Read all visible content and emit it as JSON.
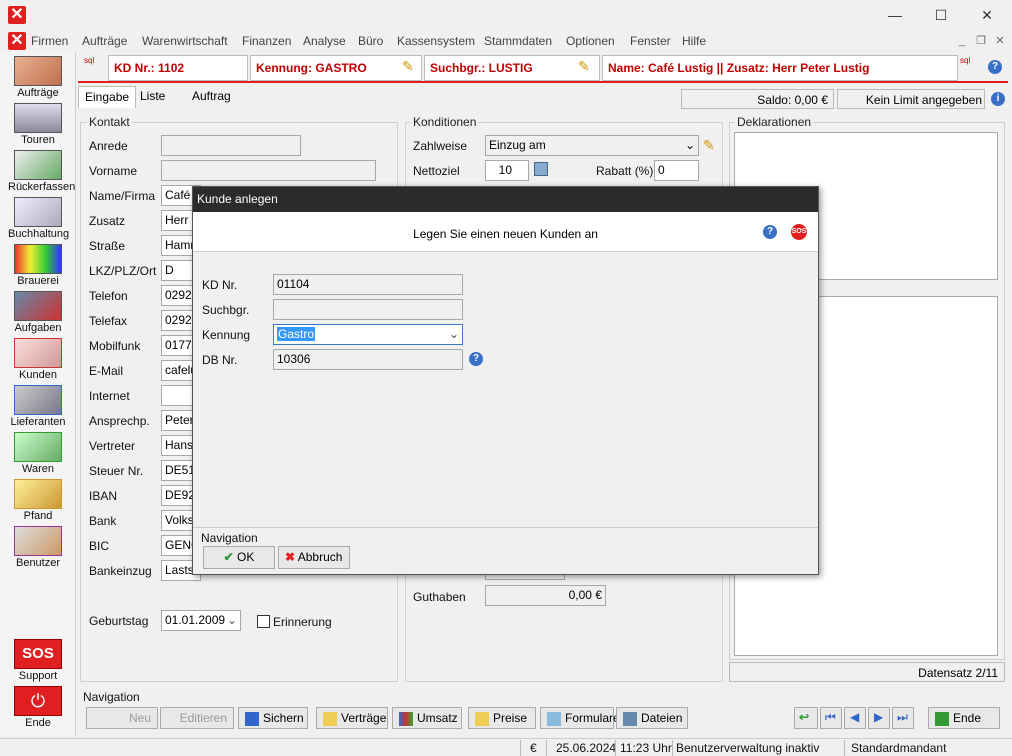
{
  "window": {
    "minimize": "—",
    "maximize": "☐",
    "close": "✕"
  },
  "menu": [
    "Firmen",
    "Aufträge",
    "Warenwirtschaft",
    "Finanzen",
    "Analyse",
    "Büro",
    "Kassensystem",
    "Stammdaten",
    "Optionen",
    "Fenster",
    "Hilfe"
  ],
  "sidebar": [
    "Aufträge",
    "Touren",
    "Rückerfassen",
    "Buchhaltung",
    "Brauerei",
    "Aufgaben",
    "Kunden",
    "Lieferanten",
    "Waren",
    "Pfand",
    "Benutzer",
    "Support",
    "Ende"
  ],
  "header": {
    "kd_nr": "KD Nr.: 1102",
    "kennung": "Kennung: GASTRO",
    "suchbgr": "Suchbgr.: LUSTIG",
    "name": "Name: Café Lustig || Zusatz: Herr Peter Lustig",
    "sql": "sql"
  },
  "tabs": [
    "Eingabe",
    "Liste",
    "Auftrag"
  ],
  "saldo": "Saldo: 0,00 €",
  "limit": "Kein Limit angegeben",
  "kontakt": {
    "title": "Kontakt",
    "labels": [
      "Anrede",
      "Vorname",
      "Name/Firma",
      "Zusatz",
      "Straße",
      "LKZ/PLZ/Ort",
      "Telefon",
      "Telefax",
      "Mobilfunk",
      "E-Mail",
      "Internet",
      "Ansprechp.",
      "Vertreter",
      "Steuer Nr.",
      "IBAN",
      "Bank",
      "BIC",
      "Bankeinzug"
    ],
    "values": [
      "",
      "",
      "Café L",
      "Herr P",
      "Hamm",
      "D",
      "02924",
      "02924",
      "0177-",
      "cafelu",
      "",
      "Peter",
      "Hans",
      "DE51",
      "DE92",
      "Volks",
      "GENO",
      "Lasts"
    ],
    "geburtstag_label": "Geburtstag",
    "geburtstag": "01.01.2009",
    "erinnerung": "Erinnerung"
  },
  "konditionen": {
    "title": "Konditionen",
    "zahlweise_label": "Zahlweise",
    "zahlweise": "Einzug am",
    "nettoziel_label": "Nettoziel",
    "nettoziel": "10",
    "rabatt_label": "Rabatt (%)",
    "rabatt": "0",
    "guthaben_label": "Guthaben",
    "guthaben": "0,00 €"
  },
  "deklarationen": {
    "title": "Deklarationen"
  },
  "datensatz": "Datensatz 2/11",
  "navigation": {
    "title": "Navigation",
    "buttons": [
      "Neu",
      "Editieren",
      "Sichern",
      "Verträge",
      "Umsatz",
      "Preise",
      "Formulare",
      "Dateien"
    ],
    "ende": "Ende"
  },
  "status": {
    "currency": "€",
    "date": "25.06.2024",
    "time": "11:23 Uhr",
    "info": "Benutzerverwaltung inaktiv",
    "mandant": "Standardmandant"
  },
  "dialog": {
    "title": "Kunde anlegen",
    "subtitle": "Legen Sie einen neuen Kunden an",
    "kd_label": "KD Nr.",
    "kd_value": "01104",
    "such_label": "Suchbgr.",
    "such_value": "",
    "kennung_label": "Kennung",
    "kennung_value": "Gastro",
    "db_label": "DB Nr.",
    "db_value": "10306",
    "nav_title": "Navigation",
    "ok": "OK",
    "abbruch": "Abbruch",
    "sos": "SOS"
  },
  "colors": {
    "accent": "#e02020",
    "header_text": "#c00000",
    "dialog_title": "#2b2b2b",
    "select_highlight": "#3399ff"
  }
}
